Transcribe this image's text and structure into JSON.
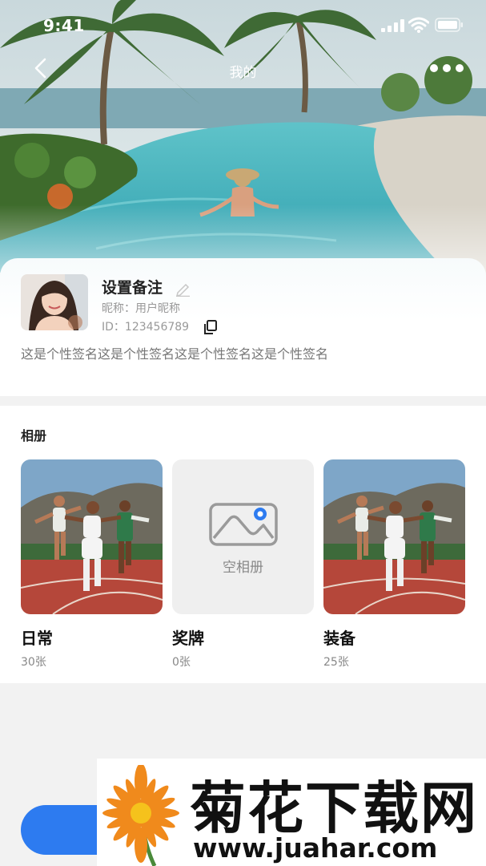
{
  "status_bar": {
    "time": "9:41"
  },
  "nav": {
    "title": "我的"
  },
  "profile": {
    "remark": "设置备注",
    "nickname_label": "昵称：",
    "nickname": "用户昵称",
    "id_label": "ID：",
    "id": "123456789",
    "signature": "这是个性签名这是个性签名这是个性签名这是个性签名"
  },
  "albums": {
    "title": "相册",
    "items": [
      {
        "name": "日常",
        "count": "30张",
        "type": "photo"
      },
      {
        "name": "奖牌",
        "count": "0张",
        "type": "empty",
        "empty_label": "空相册"
      },
      {
        "name": "装备",
        "count": "25张",
        "type": "photo"
      }
    ]
  },
  "watermark": {
    "title": "菊花下载网",
    "url": "www.juahar.com"
  },
  "colors": {
    "accent_blue": "#2d7bf0",
    "pool": "#4fb9c2",
    "track": "#b5473a"
  }
}
